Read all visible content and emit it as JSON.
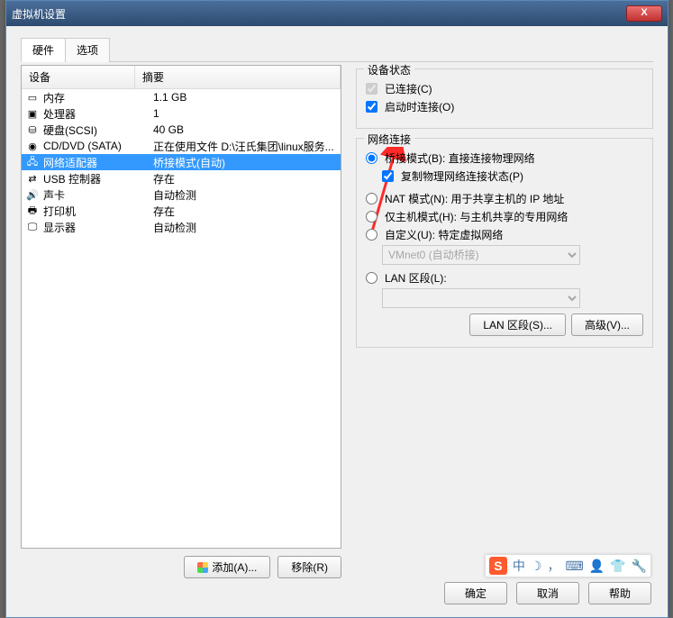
{
  "window": {
    "title": "虚拟机设置",
    "close": "X"
  },
  "tabs": {
    "hardware": "硬件",
    "options": "选项"
  },
  "columns": {
    "device": "设备",
    "summary": "摘要"
  },
  "hw": [
    {
      "icon": "memory-icon",
      "dev": "内存",
      "sum": "1.1 GB"
    },
    {
      "icon": "cpu-icon",
      "dev": "处理器",
      "sum": "1"
    },
    {
      "icon": "hdd-icon",
      "dev": "硬盘(SCSI)",
      "sum": "40 GB"
    },
    {
      "icon": "disc-icon",
      "dev": "CD/DVD (SATA)",
      "sum": "正在使用文件 D:\\汪氏集团\\linux服务..."
    },
    {
      "icon": "nic-icon",
      "dev": "网络适配器",
      "sum": "桥接模式(自动)"
    },
    {
      "icon": "usb-icon",
      "dev": "USB 控制器",
      "sum": "存在"
    },
    {
      "icon": "sound-icon",
      "dev": "声卡",
      "sum": "自动检测"
    },
    {
      "icon": "printer-icon",
      "dev": "打印机",
      "sum": "存在"
    },
    {
      "icon": "display-icon",
      "dev": "显示器",
      "sum": "自动检测"
    }
  ],
  "leftBtns": {
    "add": "添加(A)...",
    "remove": "移除(R)"
  },
  "status": {
    "legend": "设备状态",
    "connected": "已连接(C)",
    "connectAtPowerOn": "启动时连接(O)"
  },
  "net": {
    "legend": "网络连接",
    "bridged": "桥接模式(B): 直接连接物理网络",
    "replicate": "复制物理网络连接状态(P)",
    "nat": "NAT 模式(N): 用于共享主机的 IP 地址",
    "hostonly": "仅主机模式(H): 与主机共享的专用网络",
    "custom": "自定义(U): 特定虚拟网络",
    "vmnet": "VMnet0 (自动桥接)",
    "lanseg": "LAN 区段(L):",
    "lansegBtn": "LAN 区段(S)...",
    "advBtn": "高级(V)..."
  },
  "dialog": {
    "ok": "确定",
    "cancel": "取消",
    "help": "帮助"
  },
  "ime": {
    "zhong": "中"
  }
}
